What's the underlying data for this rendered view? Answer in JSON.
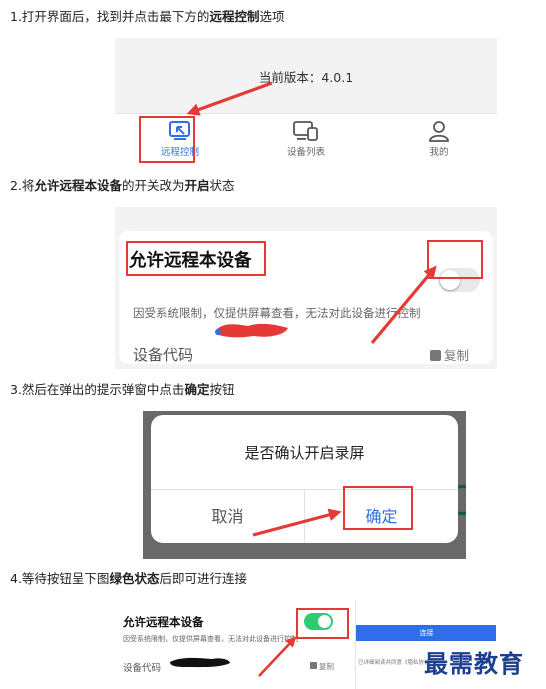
{
  "steps": [
    {
      "prefix": "1.打开界面后，找到并点击最下方的",
      "bold": "远程控制",
      "suffix": "选项"
    },
    {
      "prefix": "2.将",
      "bold": "允许远程本设备",
      "middle": "的开关改为",
      "bold2": "开启",
      "suffix": "状态"
    },
    {
      "prefix": "3.然后在弹出的提示弹窗中点击",
      "bold": "确定",
      "suffix": "按钮"
    },
    {
      "prefix": "4.等待按钮呈下图",
      "bold": "绿色状态",
      "suffix": "后即可进行连接"
    }
  ],
  "panel1": {
    "version_text": "当前版本：4.0.1",
    "tabs": [
      {
        "label": "远程控制",
        "icon": "remote-control-icon",
        "active": true
      },
      {
        "label": "设备列表",
        "icon": "device-list-icon",
        "active": false
      },
      {
        "label": "我的",
        "icon": "user-icon",
        "active": false
      }
    ]
  },
  "panel2": {
    "title": "允许远程本设备",
    "description": "因受系统限制，仅提供屏幕查看，无法对此设备进行控制",
    "code_label": "设备代码",
    "copy_label": "复制",
    "toggle_on": false
  },
  "panel3": {
    "message": "是否确认开启录屏",
    "cancel_label": "取消",
    "ok_label": "确定"
  },
  "panel4": {
    "title": "允许远程本设备",
    "description": "因受系统限制，仅提供屏幕查看，无法对此设备进行控制",
    "code_label": "设备代码",
    "copy_label": "复制",
    "connect_label": "连接",
    "hint_text": "已详细阅读并同意《隐私协议》",
    "toggle_on": true
  },
  "watermark": "最需教育",
  "colors": {
    "accent_red": "#e53935",
    "active_blue": "#2f6ee6",
    "toggle_green": "#2ecc71"
  }
}
